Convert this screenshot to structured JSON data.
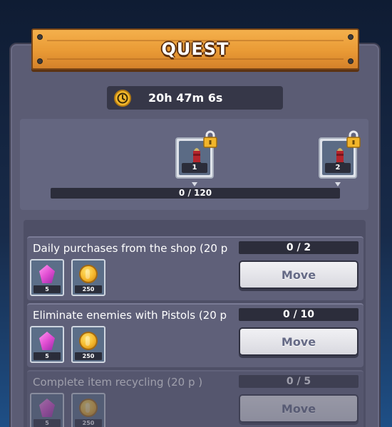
{
  "header": {
    "title": "QUEST"
  },
  "timer": {
    "text": "20h 47m 6s",
    "icon": "clock-icon"
  },
  "milestones": {
    "rewards": [
      {
        "number": "1",
        "icon": "bullet-icon",
        "locked": true
      },
      {
        "number": "2",
        "icon": "bullet-icon",
        "locked": true
      }
    ],
    "progress_text": "0 / 120",
    "progress_value": 0,
    "progress_max": 120
  },
  "quests": [
    {
      "title": "Daily purchases from the shop (20 p",
      "count": "0 / 2",
      "rewards": [
        {
          "icon": "gem-icon",
          "qty": "5"
        },
        {
          "icon": "coin-icon",
          "qty": "250"
        }
      ],
      "button": "Move"
    },
    {
      "title": "Eliminate enemies with Pistols (20 p",
      "count": "0 / 10",
      "rewards": [
        {
          "icon": "gem-icon",
          "qty": "5"
        },
        {
          "icon": "coin-icon",
          "qty": "250"
        }
      ],
      "button": "Move"
    },
    {
      "title": "Complete item recycling (20 p )",
      "count": "0 / 5",
      "rewards": [
        {
          "icon": "gem-icon",
          "qty": "5"
        },
        {
          "icon": "coin-icon",
          "qty": "250"
        }
      ],
      "button": "Move"
    }
  ],
  "colors": {
    "banner": "#e99a35",
    "panel": "#5b5c74",
    "accent_gold": "#f3b82c",
    "gem": "#e24fd3"
  }
}
